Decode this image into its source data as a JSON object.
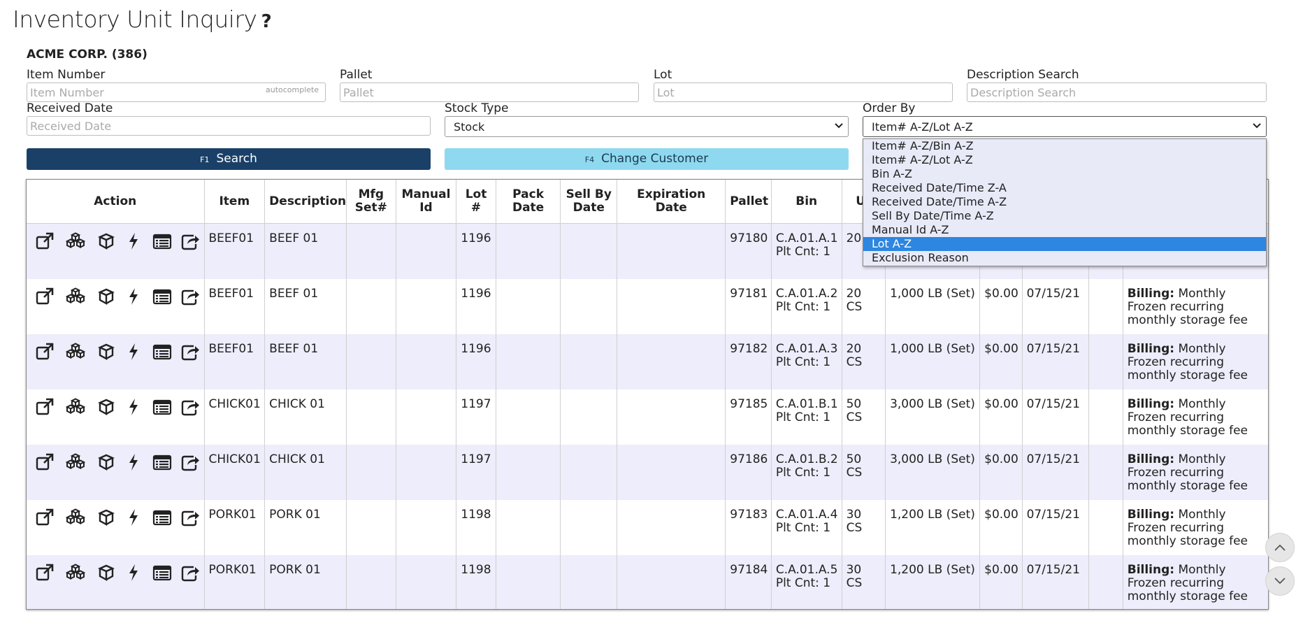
{
  "page": {
    "title": "Inventory Unit Inquiry",
    "help": "?"
  },
  "customer": "ACME CORP. (386)",
  "filters": {
    "item_number": {
      "label": "Item Number",
      "placeholder": "Item Number",
      "hint": "autocomplete"
    },
    "pallet": {
      "label": "Pallet",
      "placeholder": "Pallet"
    },
    "lot": {
      "label": "Lot",
      "placeholder": "Lot"
    },
    "description": {
      "label": "Description Search",
      "placeholder": "Description Search"
    },
    "received_date": {
      "label": "Received Date",
      "placeholder": "Received Date"
    },
    "stock_type": {
      "label": "Stock Type",
      "value": "Stock"
    },
    "order_by": {
      "label": "Order By",
      "value": "Item# A-Z/Lot A-Z",
      "options": [
        "Item# A-Z/Bin A-Z",
        "Item# A-Z/Lot A-Z",
        "Bin A-Z",
        "Received Date/Time Z-A",
        "Received Date/Time A-Z",
        "Sell By Date/Time A-Z",
        "Manual Id A-Z",
        "Lot A-Z",
        "Exclusion Reason"
      ],
      "highlighted": "Lot A-Z"
    }
  },
  "buttons": {
    "search": {
      "key": "F1",
      "label": "Search"
    },
    "change_customer": {
      "key": "F4",
      "label": "Change Customer"
    }
  },
  "table": {
    "headers": {
      "action": "Action",
      "item": "Item",
      "description": "Description",
      "mfg": "Mfg Set#",
      "manual": "Manual Id",
      "lot": "Lot #",
      "pack": "Pack Date",
      "sellby": "Sell By Date",
      "expiration": "Expiration Date",
      "pallet": "Pallet",
      "bin": "Bin",
      "units": "Ur"
    },
    "rows": [
      {
        "item": "BEEF01",
        "description": "BEEF 01",
        "mfg": "",
        "manual": "",
        "lot": "1196",
        "pack": "",
        "sellby": "",
        "expiration": "",
        "pallet": "97180",
        "bin": "C.A.01.A.1",
        "plt": "Plt Cnt: 1",
        "units": "20",
        "weight": "",
        "amount": "",
        "date": "",
        "extra": "",
        "billing_label": "",
        "billing_text": ""
      },
      {
        "item": "BEEF01",
        "description": "BEEF 01",
        "mfg": "",
        "manual": "",
        "lot": "1196",
        "pack": "",
        "sellby": "",
        "expiration": "",
        "pallet": "97181",
        "bin": "C.A.01.A.2",
        "plt": "Plt Cnt: 1",
        "units": "20 CS",
        "weight": "1,000 LB (Set)",
        "amount": "$0.00",
        "date": "07/15/21",
        "extra": "",
        "billing_label": "Billing:",
        "billing_text": "Monthly Frozen recurring monthly storage fee"
      },
      {
        "item": "BEEF01",
        "description": "BEEF 01",
        "mfg": "",
        "manual": "",
        "lot": "1196",
        "pack": "",
        "sellby": "",
        "expiration": "",
        "pallet": "97182",
        "bin": "C.A.01.A.3",
        "plt": "Plt Cnt: 1",
        "units": "20 CS",
        "weight": "1,000 LB (Set)",
        "amount": "$0.00",
        "date": "07/15/21",
        "extra": "",
        "billing_label": "Billing:",
        "billing_text": "Monthly Frozen recurring monthly storage fee"
      },
      {
        "item": "CHICK01",
        "description": "CHICK 01",
        "mfg": "",
        "manual": "",
        "lot": "1197",
        "pack": "",
        "sellby": "",
        "expiration": "",
        "pallet": "97185",
        "bin": "C.A.01.B.1",
        "plt": "Plt Cnt: 1",
        "units": "50 CS",
        "weight": "3,000 LB (Set)",
        "amount": "$0.00",
        "date": "07/15/21",
        "extra": "",
        "billing_label": "Billing:",
        "billing_text": "Monthly Frozen recurring monthly storage fee"
      },
      {
        "item": "CHICK01",
        "description": "CHICK 01",
        "mfg": "",
        "manual": "",
        "lot": "1197",
        "pack": "",
        "sellby": "",
        "expiration": "",
        "pallet": "97186",
        "bin": "C.A.01.B.2",
        "plt": "Plt Cnt: 1",
        "units": "50 CS",
        "weight": "3,000 LB (Set)",
        "amount": "$0.00",
        "date": "07/15/21",
        "extra": "",
        "billing_label": "Billing:",
        "billing_text": "Monthly Frozen recurring monthly storage fee"
      },
      {
        "item": "PORK01",
        "description": "PORK 01",
        "mfg": "",
        "manual": "",
        "lot": "1198",
        "pack": "",
        "sellby": "",
        "expiration": "",
        "pallet": "97183",
        "bin": "C.A.01.A.4",
        "plt": "Plt Cnt: 1",
        "units": "30 CS",
        "weight": "1,200 LB (Set)",
        "amount": "$0.00",
        "date": "07/15/21",
        "extra": "",
        "billing_label": "Billing:",
        "billing_text": "Monthly Frozen recurring monthly storage fee"
      },
      {
        "item": "PORK01",
        "description": "PORK 01",
        "mfg": "",
        "manual": "",
        "lot": "1198",
        "pack": "",
        "sellby": "",
        "expiration": "",
        "pallet": "97184",
        "bin": "C.A.01.A.5",
        "plt": "Plt Cnt: 1",
        "units": "30 CS",
        "weight": "1,200 LB (Set)",
        "amount": "$0.00",
        "date": "07/15/21",
        "extra": "",
        "billing_label": "Billing:",
        "billing_text": "Monthly Frozen recurring monthly storage fee"
      }
    ]
  },
  "icons": {
    "row_actions": [
      "external-link-icon",
      "cubes-icon",
      "cube-icon",
      "bolt-icon",
      "list-card-icon",
      "share-icon"
    ],
    "scroll_up": "chevron-up-icon",
    "scroll_down": "chevron-down-icon"
  }
}
